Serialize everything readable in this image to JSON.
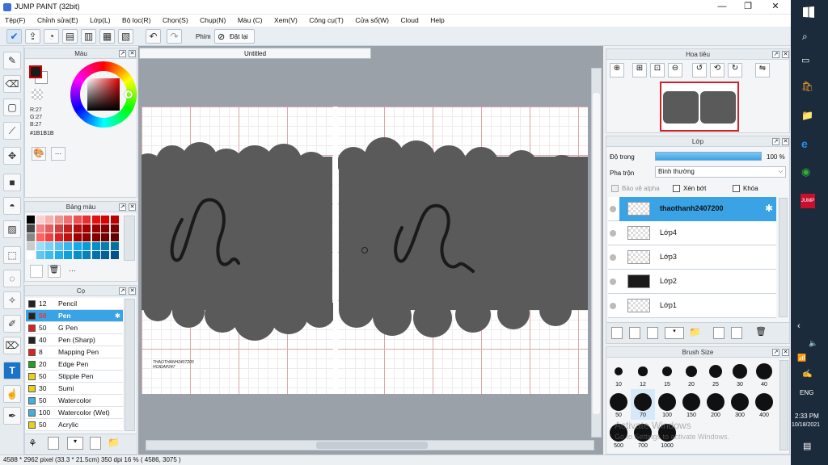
{
  "app": {
    "title": "JUMP PAINT (32bit)",
    "min": "—",
    "max": "❐",
    "close": "✕"
  },
  "menu": [
    "Tệp(F)",
    "Chỉnh sửa(E)",
    "Lớp(L)",
    "Bộ lọc(R)",
    "Chọn(S)",
    "Chụp(N)",
    "Màu (C)",
    "Xem(V)",
    "Công cụ(T)",
    "Cửa sổ(W)",
    "Cloud",
    "Help"
  ],
  "toolbar": {
    "phim_label": "Phím",
    "reset_label": "Đặt lại"
  },
  "color_panel": {
    "title": "Màu",
    "r": "R:27",
    "g": "G:27",
    "b": "B:27",
    "hex": "#1B1B1B",
    "fg": "#1b1b1b"
  },
  "palette_panel": {
    "title": "Bảng màu",
    "more": "···"
  },
  "brush_panel": {
    "title": "Cọ",
    "items": [
      {
        "size": "12",
        "name": "Pencil",
        "color": "#222222"
      },
      {
        "size": "50",
        "name": "Pen",
        "color": "#222222",
        "selected": true
      },
      {
        "size": "50",
        "name": "G Pen",
        "color": "#e02020"
      },
      {
        "size": "40",
        "name": "Pen (Sharp)",
        "color": "#222222"
      },
      {
        "size": "8",
        "name": "Mapping Pen",
        "color": "#e02020"
      },
      {
        "size": "20",
        "name": "Edge Pen",
        "color": "#22a022"
      },
      {
        "size": "50",
        "name": "Stipple Pen",
        "color": "#e8d020"
      },
      {
        "size": "30",
        "name": "Sumi",
        "color": "#e8d020"
      },
      {
        "size": "50",
        "name": "Watercolor",
        "color": "#40b0e0"
      },
      {
        "size": "100",
        "name": "Watercolor (Wet)",
        "color": "#40b0e0"
      },
      {
        "size": "50",
        "name": "Acrylic",
        "color": "#e8d020"
      }
    ]
  },
  "canvas": {
    "tab": "Untitled",
    "signature": "THAOTHANH2407200\nHOIDAP247"
  },
  "navigator": {
    "title": "Hoa tiêu"
  },
  "layer_panel": {
    "title": "Lớp",
    "opacity_label": "Độ trong",
    "opacity_value": "100 %",
    "opacity": 1.0,
    "blend_label": "Pha trộn",
    "blend_value": "Bình thường",
    "protect_alpha": "Bảo vệ alpha",
    "clip": "Xén bớt",
    "lock": "Khóa",
    "layers": [
      "thaothanh2407200",
      "Lớp4",
      "Lớp3",
      "Lớp2",
      "Lớp1"
    ]
  },
  "brushsize_panel": {
    "title": "Brush Size",
    "row1": [
      "10",
      "12",
      "15",
      "20",
      "25",
      "30",
      "40"
    ],
    "row2": [
      "50",
      "70",
      "100",
      "150",
      "200",
      "300",
      "400"
    ],
    "row3": [
      "500",
      "700",
      "1000"
    ]
  },
  "watermark": {
    "line1": "Activate Windows",
    "line2": "Go to Settings to activate Windows."
  },
  "status": {
    "text": "4588 * 2962 pixel   (33.3 * 21.5cm)   350 dpi   16 %   ( 4586, 3075 )"
  },
  "taskbar": {
    "lang": "ENG",
    "time": "2:33 PM",
    "date": "10/18/2021"
  }
}
